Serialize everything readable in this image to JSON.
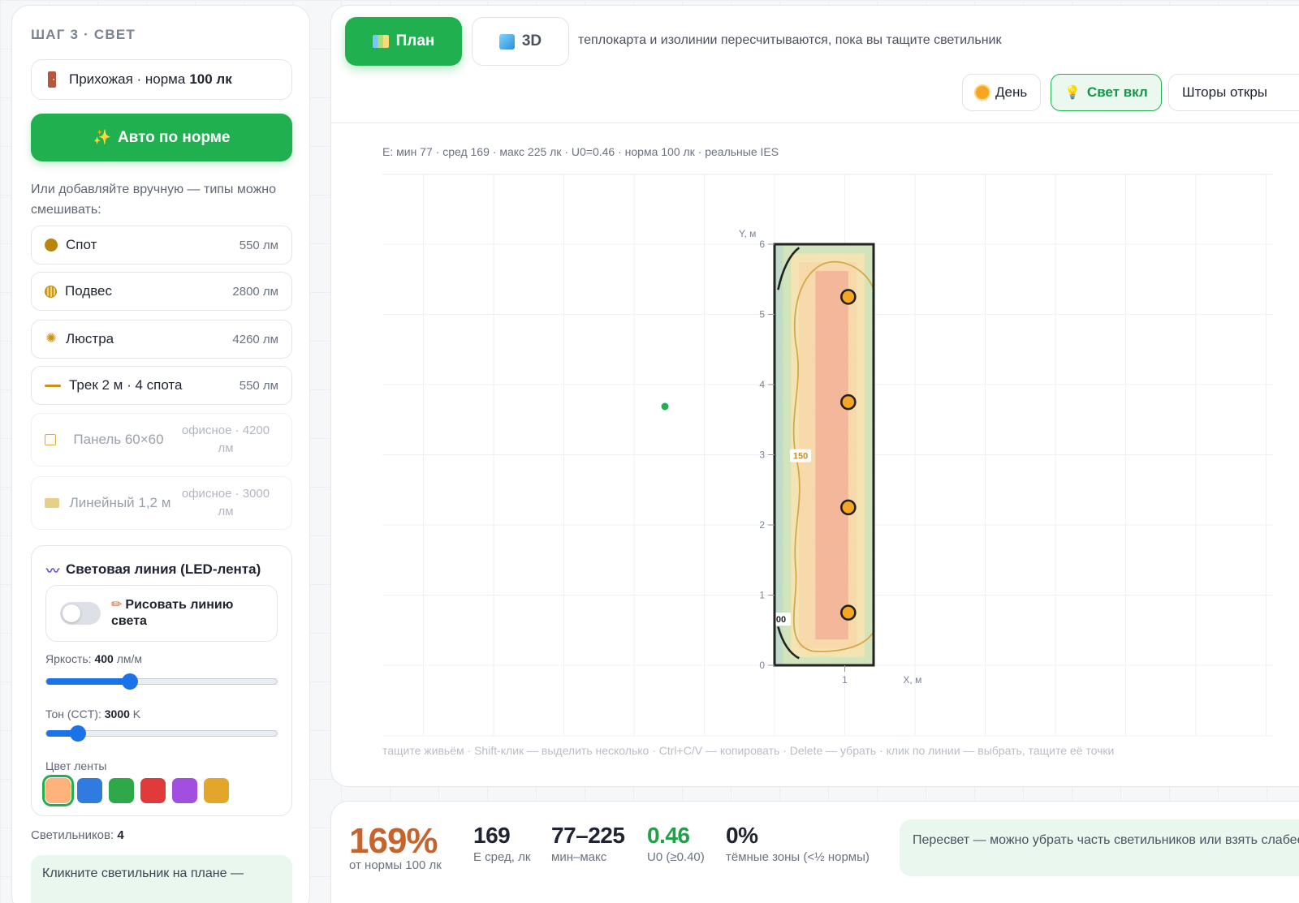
{
  "sidebar": {
    "step_title": "ШАГ 3 · СВЕТ",
    "room": {
      "prefix": "Прихожая · норма",
      "norm": "100 лк"
    },
    "auto_button": "Авто по норме",
    "hint": "Или добавляйте вручную — типы можно смешивать:",
    "fixtures": [
      {
        "name": "Спот",
        "lumens": "550 лм",
        "icon": "spot-icon"
      },
      {
        "name": "Подвес",
        "lumens": "2800 лм",
        "icon": "pendant-icon"
      },
      {
        "name": "Люстра",
        "lumens": "4260 лм",
        "icon": "chandelier-icon"
      },
      {
        "name": "Трек 2 м · 4 спота",
        "lumens": "550 лм",
        "icon": "track-icon"
      },
      {
        "name": "Панель 60×60",
        "lumens": "офисное · 4200 лм",
        "icon": "panel-icon",
        "disabled": true
      },
      {
        "name": "Линейный 1,2 м",
        "lumens": "офисное · 3000 лм",
        "icon": "linear-icon",
        "disabled": true
      }
    ],
    "led": {
      "title": "Световая линия (LED-лента)",
      "draw_label": "Рисовать линию света",
      "draw_enabled": false,
      "brightness_label": "Яркость:",
      "brightness_value": "400",
      "brightness_unit": "лм/м",
      "brightness_fraction": 0.35,
      "tone_label": "Тон (CCT):",
      "tone_value": "3000",
      "tone_unit": "K",
      "tone_fraction": 0.11,
      "color_label": "Цвет ленты",
      "colors": [
        "#ffb27a",
        "#2f7be0",
        "#2fa84a",
        "#e03a3a",
        "#a24fe0",
        "#e3a62a"
      ],
      "selected_color": 0
    },
    "count_label": "Светильников:",
    "count_value": "4",
    "tip": "Кликните светильник на плане —"
  },
  "main": {
    "tabs": [
      {
        "label": "План",
        "icon": "map-icon",
        "active": true
      },
      {
        "label": "3D",
        "icon": "cube-icon",
        "active": false
      }
    ],
    "tab_note": "теплокарта и изолинии пересчитываются, пока вы тащите светильник",
    "modes": [
      {
        "label": "День",
        "icon": "sun-icon"
      },
      {
        "label": "Свет вкл",
        "icon": "bulb-icon",
        "active": true
      },
      {
        "label": "Шторы откры",
        "icon": ""
      }
    ],
    "stats_line": "E: мин 77 · сред 169 · макс 225 лк · U0=0.46 · норма 100 лк · реальные IES",
    "footer_hint": "тащите живьём · Shift-клик — выделить несколько · Ctrl+C/V — копировать · Delete — убрать · клик по линии — выбрать, тащите её точки",
    "plan": {
      "y_axis_label": "Y, м",
      "x_axis_label": "X, м",
      "y_ticks": [
        "0",
        "1",
        "2",
        "3",
        "4",
        "5",
        "6"
      ],
      "x_ticks": [
        "1"
      ],
      "room_width_m": 1.4,
      "room_length_m": 6,
      "contour_label_inner": "150",
      "contour_label_edge": "00",
      "lights_y_m": [
        0.75,
        2.25,
        3.75,
        5.25
      ],
      "lights_x_m": 1.05,
      "colors": {
        "hot": "#f2b496",
        "warm": "#f7d7a8",
        "mild": "#f3e3b0",
        "cool": "#cfe3b8",
        "edge": "#bcd9c9",
        "contour": "#d4a84a",
        "light": "#f5a623"
      }
    }
  },
  "stats": {
    "main_value": "169%",
    "main_label": "от нормы 100 лк",
    "kpis": [
      {
        "value": "169",
        "label": "E сред, лк"
      },
      {
        "value": "77–225",
        "label": "мин–макс"
      },
      {
        "value": "0.46",
        "label": "U0 (≥0.40)",
        "green": true
      },
      {
        "value": "0%",
        "label": "тёмные зоны (<½ нормы)"
      }
    ],
    "advice": "Пересвет — можно убрать часть светильников или взять слабее."
  }
}
